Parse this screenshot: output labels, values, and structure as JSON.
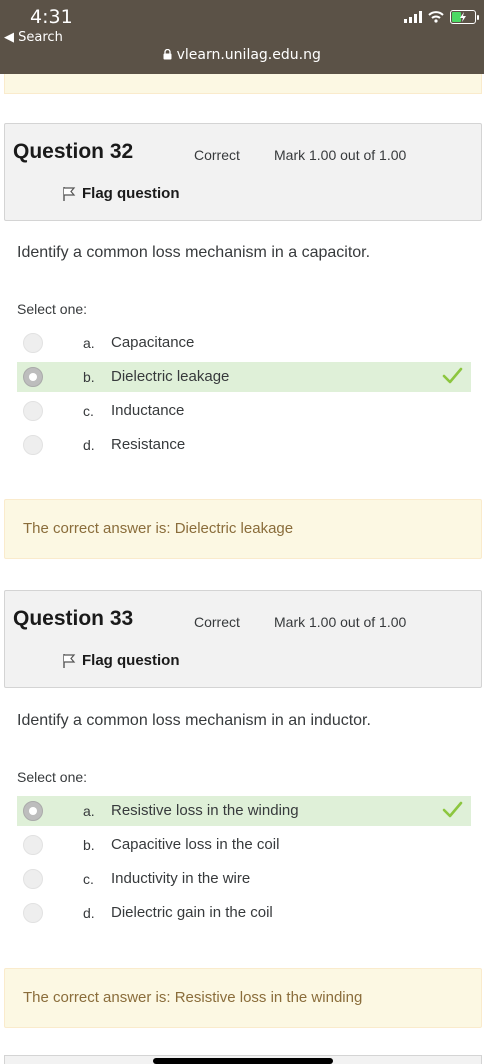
{
  "status_bar": {
    "time": "4:31",
    "back_label": "Search",
    "url": "vlearn.unilag.edu.ng"
  },
  "questions": [
    {
      "number": "Question 32",
      "state": "Correct",
      "grade": "Mark 1.00 out of 1.00",
      "flag_label": "Flag question",
      "text": "Identify a common loss mechanism in a capacitor.",
      "prompt": "Select one:",
      "answers": [
        {
          "letter": "a.",
          "text": "Capacitance"
        },
        {
          "letter": "b.",
          "text": "Dielectric leakage"
        },
        {
          "letter": "c.",
          "text": "Inductance"
        },
        {
          "letter": "d.",
          "text": "Resistance"
        }
      ],
      "selected_index": 1,
      "feedback": "The correct answer is: Dielectric leakage"
    },
    {
      "number": "Question 33",
      "state": "Correct",
      "grade": "Mark 1.00 out of 1.00",
      "flag_label": "Flag question",
      "text": "Identify a common loss mechanism in an inductor.",
      "prompt": "Select one:",
      "answers": [
        {
          "letter": "a.",
          "text": "Resistive loss in the winding"
        },
        {
          "letter": "b.",
          "text": "Capacitive loss in the coil"
        },
        {
          "letter": "c.",
          "text": "Inductivity in the wire"
        },
        {
          "letter": "d.",
          "text": "Dielectric gain in the coil"
        }
      ],
      "selected_index": 0,
      "feedback": "The correct answer is: Resistive loss in the winding"
    }
  ],
  "colors": {
    "status_bar_bg": "#5b5247",
    "correct_bg": "#dff0d8",
    "check_icon": "#8cc63f",
    "feedback_bg": "#fcf8e3",
    "feedback_text": "#8a6d3b"
  },
  "icons": {
    "back": "back-arrow-icon",
    "lock": "lock-icon",
    "flag": "flag-icon",
    "correct": "checkmark-icon",
    "signal": "cellular-signal-icon",
    "wifi": "wifi-icon",
    "battery": "battery-charging-icon"
  }
}
